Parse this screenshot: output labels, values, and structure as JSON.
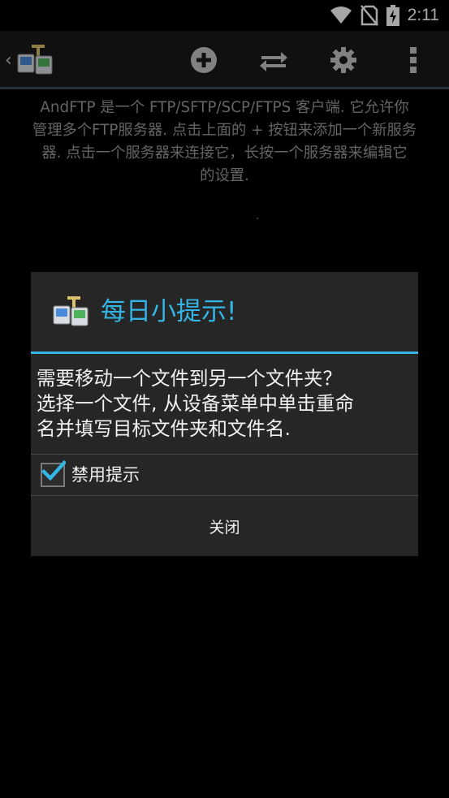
{
  "status_bar": {
    "time": "2:11",
    "icons": [
      "wifi-icon",
      "no-sim-icon",
      "battery-charging-icon"
    ]
  },
  "action_bar": {
    "icons": [
      "back-chevron-icon",
      "app-logo-icon",
      "add-server-icon",
      "transfer-icon",
      "settings-gear-icon",
      "overflow-menu-icon"
    ],
    "back_glyph": "‹"
  },
  "help_text": {
    "line1": "AndFTP 是一个 FTP/SFTP/SCP/FTPS 客户端. 它允许你",
    "line2": "管理多个FTP服务器. 点击上面的 + 按钮来添加一个新服务",
    "line3": "器. 点击一个服务器来连接它，长按一个服务器来编辑它",
    "line4": "的设置."
  },
  "dialog": {
    "title": "每日小提示!",
    "message_line1": "需要移动一个文件到另一个文件夹？",
    "message_line2": "选择一个文件, 从设备菜单中单击重命",
    "message_line3": "名并填写目标文件夹和文件名.",
    "checkbox_label": "禁用提示",
    "checkbox_checked": true,
    "close_label": "关闭"
  },
  "colors": {
    "accent": "#33b5e5",
    "background": "#000000",
    "dialog_bg": "#262626"
  }
}
